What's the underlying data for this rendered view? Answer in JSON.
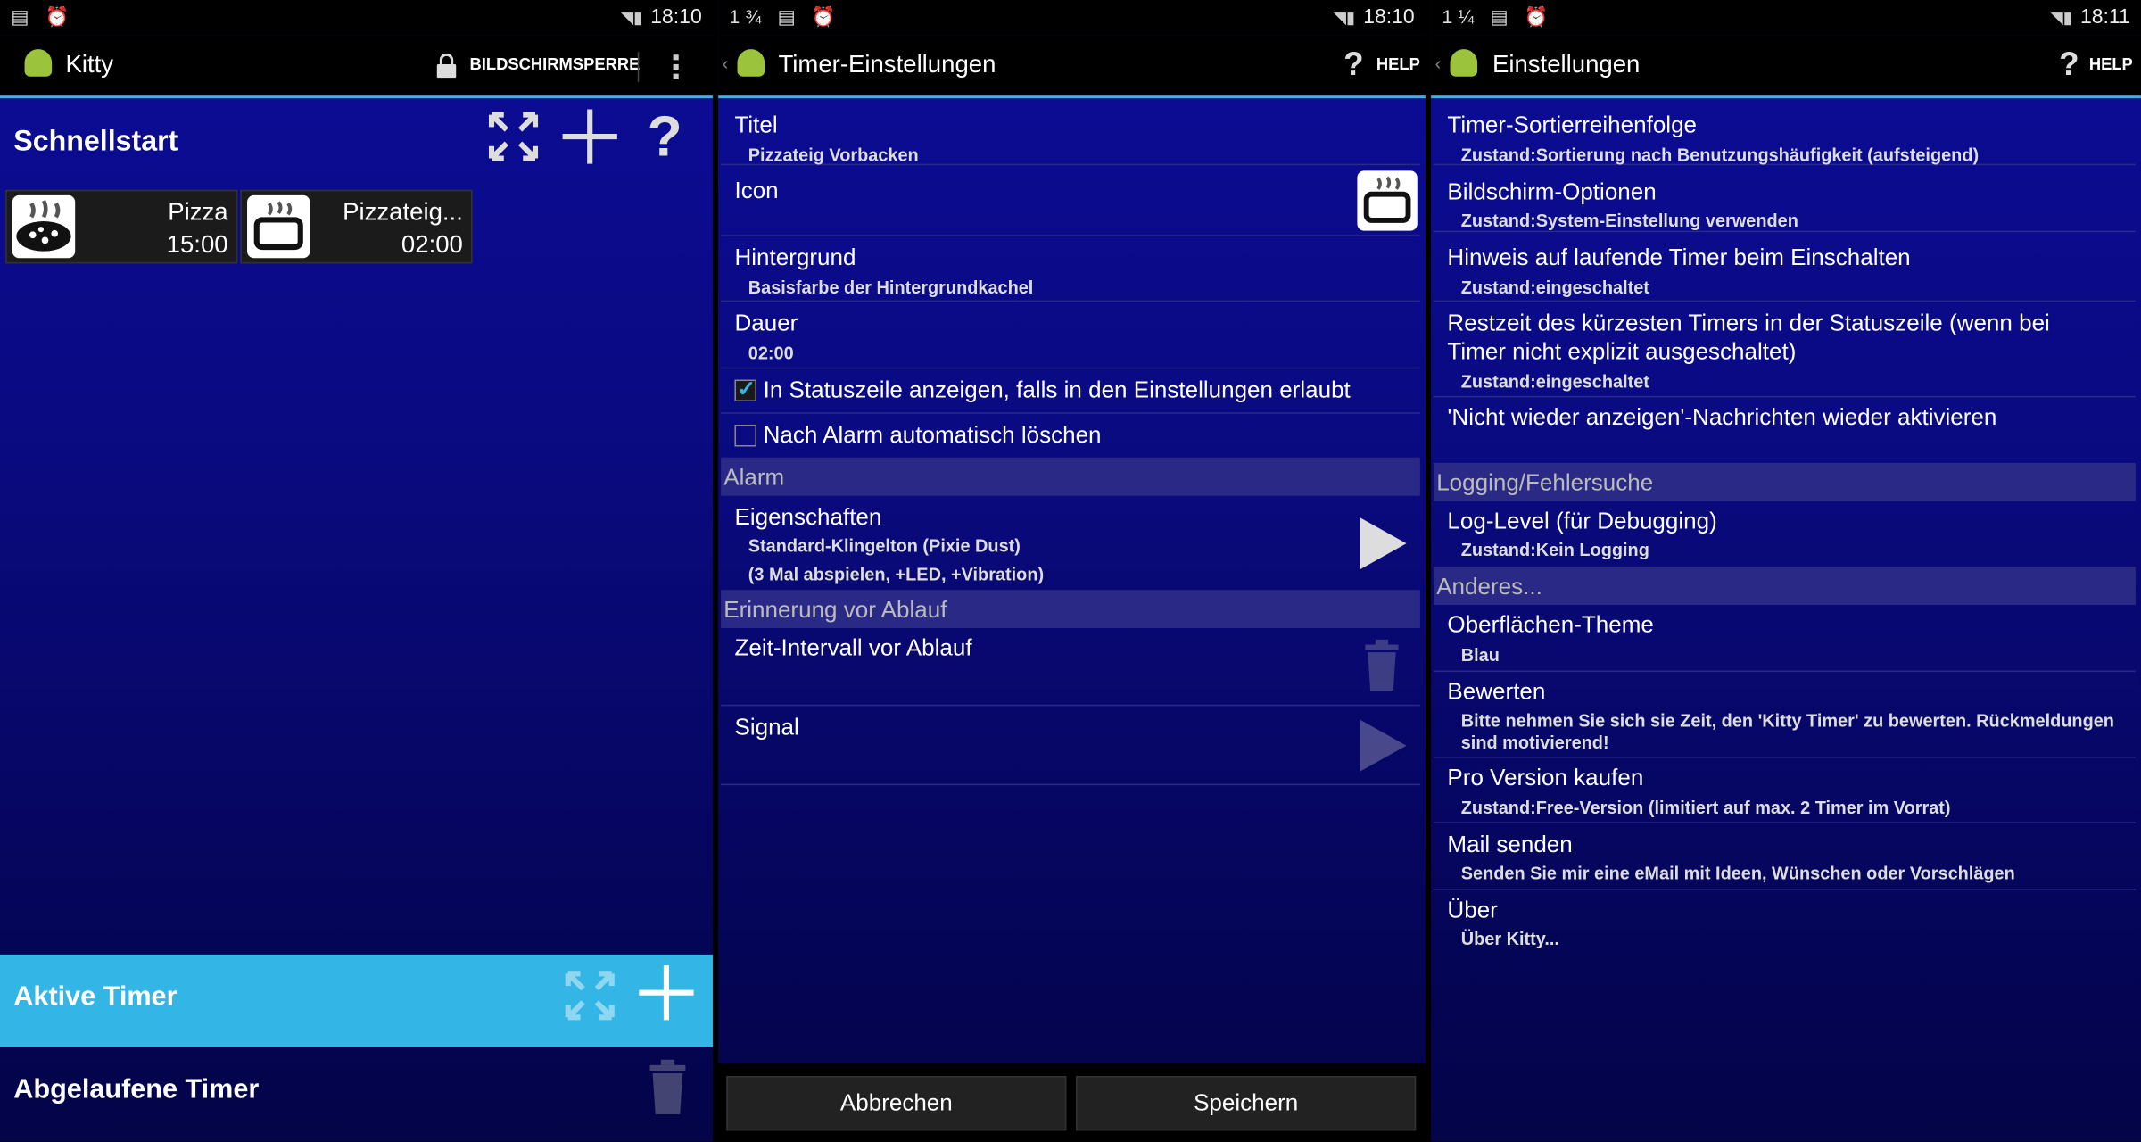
{
  "panels": {
    "p1": {
      "status": {
        "left": "▤ ⏰",
        "time": "18:10"
      },
      "title": "Kitty",
      "lock_label": "BILDSCHIRMSPERRE",
      "quickstart_title": "Schnellstart",
      "tiles": [
        {
          "name": "Pizza",
          "time": "15:00",
          "icon": "pizza-icon"
        },
        {
          "name": "Pizzateig...",
          "time": "02:00",
          "icon": "oven-icon"
        }
      ],
      "active_timers": "Aktive Timer",
      "expired_timers": "Abgelaufene Timer"
    },
    "p2": {
      "status": {
        "left": "1¾ ▤ ⏰",
        "time": "18:10"
      },
      "title": "Timer-Einstellungen",
      "help": "HELP",
      "rows": {
        "titel": {
          "label": "Titel",
          "value": "Pizzateig Vorbacken"
        },
        "icon": {
          "label": "Icon"
        },
        "hintergrund": {
          "label": "Hintergrund",
          "value": "Basisfarbe der Hintergrundkachel"
        },
        "dauer": {
          "label": "Dauer",
          "value": "02:00"
        }
      },
      "check_statuszeile": "In Statuszeile anzeigen, falls in den Einstellungen erlaubt",
      "check_loeschen": "Nach Alarm automatisch löschen",
      "cat_alarm": "Alarm",
      "eigenschaften": {
        "label": "Eigenschaften",
        "line1": "Standard-Klingelton (Pixie Dust)",
        "line2": "(3 Mal abspielen, +LED, +Vibration)"
      },
      "cat_erinnerung": "Erinnerung vor Ablauf",
      "zeit_intervall": "Zeit-Intervall vor Ablauf",
      "signal": "Signal",
      "cancel": "Abbrechen",
      "save": "Speichern"
    },
    "p3": {
      "status": {
        "left": "1¼ ▤ ⏰",
        "time": "18:11"
      },
      "title": "Einstellungen",
      "help": "HELP",
      "items": [
        {
          "t": "Timer-Sortierreihenfolge",
          "s": "Zustand:Sortierung nach Benutzungshäufigkeit (aufsteigend)"
        },
        {
          "t": "Bildschirm-Optionen",
          "s": "Zustand:System-Einstellung verwenden"
        },
        {
          "t": "Hinweis auf laufende Timer beim Einschalten",
          "s": "Zustand:eingeschaltet"
        },
        {
          "t": "Restzeit des kürzesten Timers in der Statuszeile (wenn bei",
          "t2": "Timer nicht explizit ausgeschaltet)",
          "s": "Zustand:eingeschaltet"
        },
        {
          "t": "'Nicht wieder anzeigen'-Nachrichten wieder aktivieren"
        }
      ],
      "cat_logging": "Logging/Fehlersuche",
      "loglevel": {
        "t": "Log-Level (für Debugging)",
        "s": "Zustand:Kein Logging"
      },
      "cat_anderes": "Anderes...",
      "items2": [
        {
          "t": "Oberflächen-Theme",
          "s": "Blau"
        },
        {
          "t": "Bewerten",
          "s": "Bitte nehmen Sie sich sie Zeit, den 'Kitty Timer' zu bewerten. Rückmeldungen",
          "s2": "sind motivierend!"
        },
        {
          "t": "Pro Version kaufen",
          "s": "Zustand:Free-Version (limitiert auf max. 2 Timer im Vorrat)"
        },
        {
          "t": "Mail senden",
          "s": "Senden Sie mir eine eMail mit Ideen, Wünschen oder Vorschlägen"
        },
        {
          "t": "Über",
          "s": "Über Kitty..."
        }
      ]
    }
  },
  "colors": {
    "accent": "#33b5e5",
    "android_green": "#9bc33c",
    "bg_top": "#0c0c98",
    "bg_bottom": "#040448"
  }
}
